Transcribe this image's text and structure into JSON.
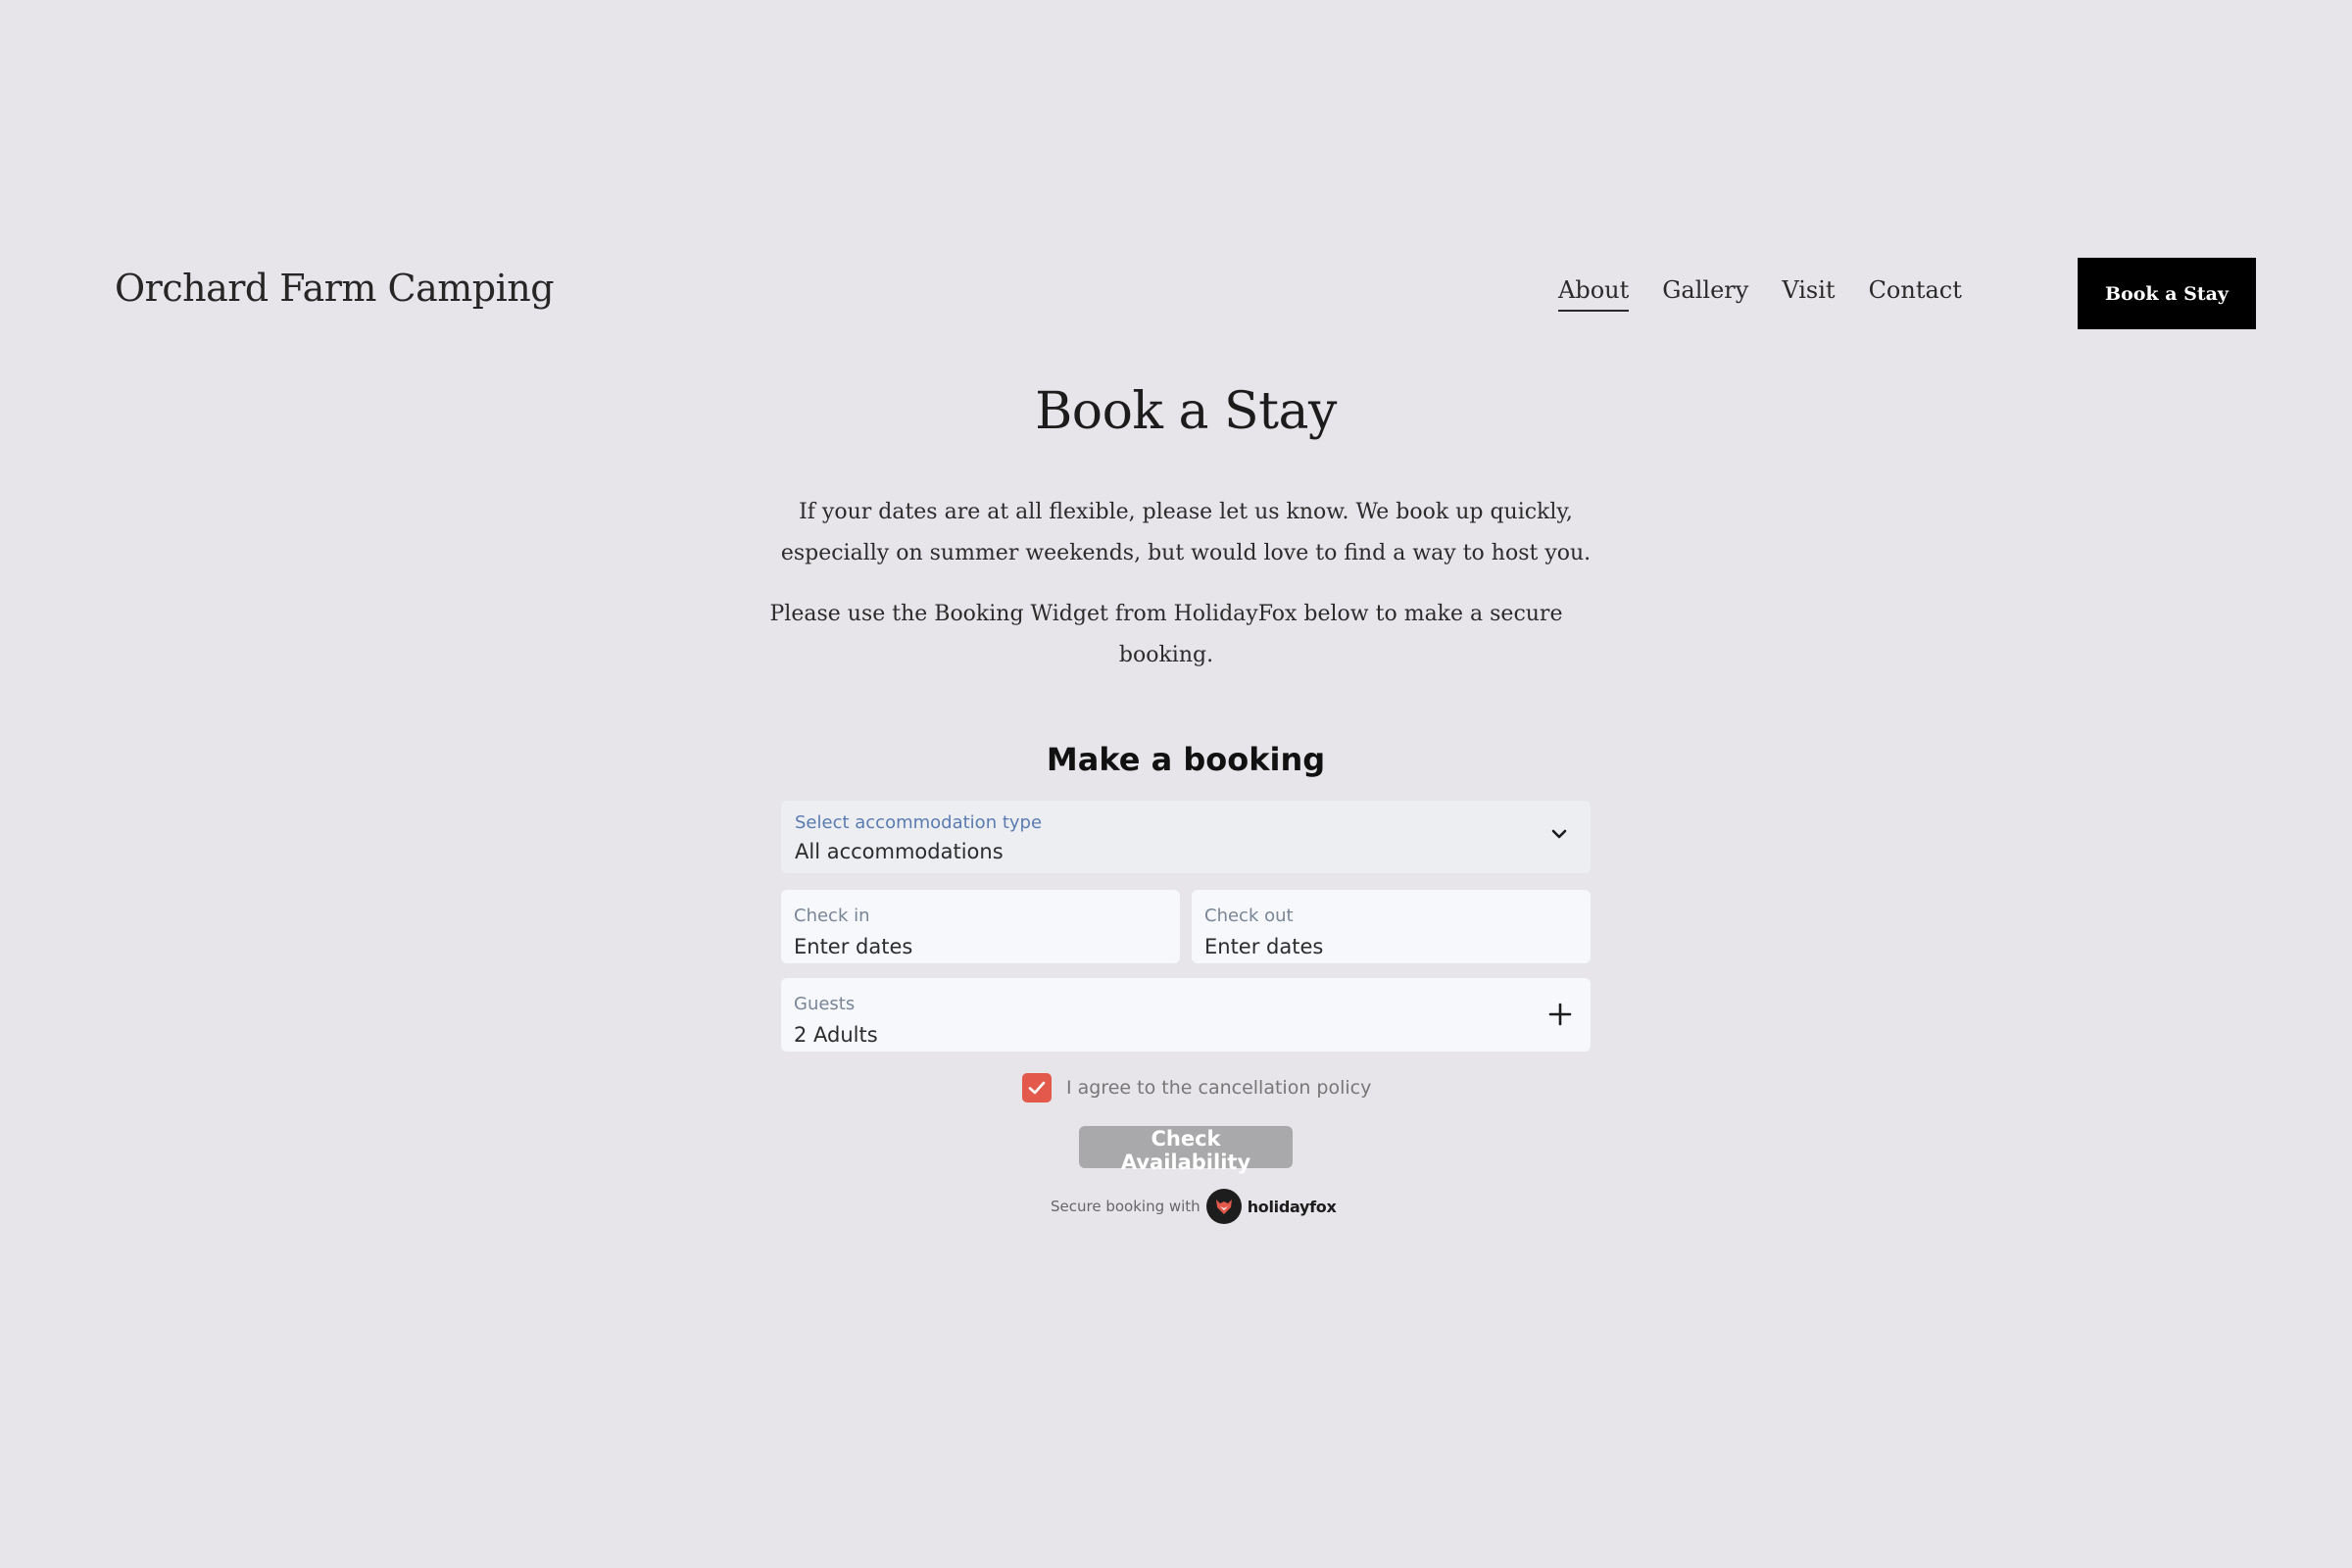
{
  "header": {
    "site_title": "Orchard Farm Camping",
    "nav": [
      {
        "label": "About",
        "active": true
      },
      {
        "label": "Gallery",
        "active": false
      },
      {
        "label": "Visit",
        "active": false
      },
      {
        "label": "Contact",
        "active": false
      }
    ],
    "cta_label": "Book a Stay"
  },
  "intro": {
    "title": "Book a Stay",
    "paragraph_1": "If your dates are at all flexible, please let us know. We book up quickly, especially on summer weekends, but would love to find a way to host you.",
    "paragraph_2": "Please use the Booking Widget from HolidayFox below to make a secure booking."
  },
  "widget": {
    "title": "Make a booking",
    "accommodation": {
      "label": "Select accommodation type",
      "value": "All accommodations",
      "icon": "chevron-down-icon"
    },
    "check_in": {
      "label": "Check in",
      "value": "Enter dates"
    },
    "check_out": {
      "label": "Check out",
      "value": "Enter dates"
    },
    "guests": {
      "label": "Guests",
      "value": "2 Adults",
      "icon": "plus-icon"
    },
    "agree": {
      "label": "I agree to the cancellation policy",
      "checked": true
    },
    "submit_label": "Check Availability",
    "secure_text": "Secure booking with",
    "brand": "holidayfox"
  },
  "colors": {
    "background": "#e7e5ea",
    "checkbox": "#e35a4c",
    "button_disabled": "#a9a9ab",
    "accent_label": "#5a7bb0",
    "cta": "#000000"
  }
}
